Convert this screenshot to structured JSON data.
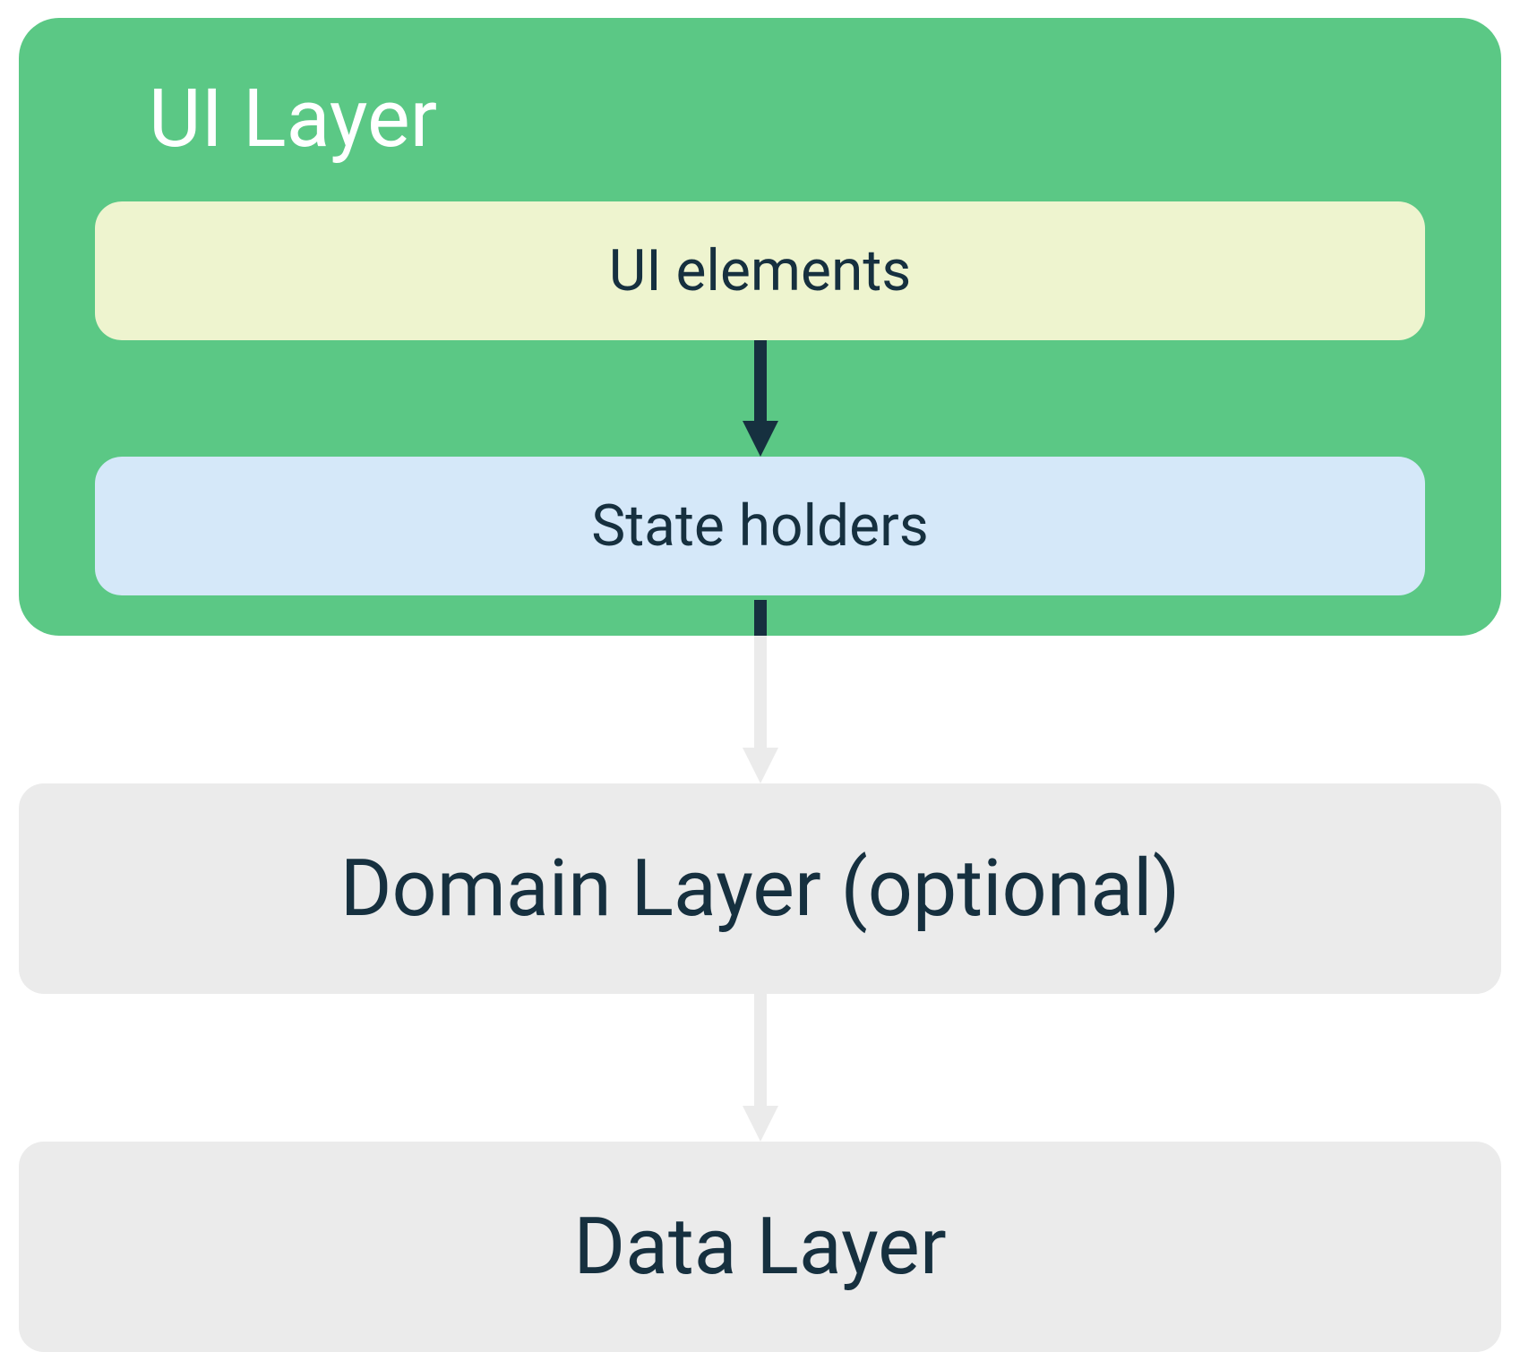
{
  "diagram": {
    "ui_layer": {
      "title": "UI Layer",
      "ui_elements_label": "UI elements",
      "state_holders_label": "State holders"
    },
    "domain_layer_label": "Domain Layer (optional)",
    "data_layer_label": "Data Layer",
    "colors": {
      "ui_layer_bg": "#5bc885",
      "ui_elements_bg": "#eef4cf",
      "state_holders_bg": "#d5e8f9",
      "outer_box_bg": "#ebebeb",
      "text_dark": "#16303f",
      "text_white": "#ffffff",
      "arrow_dark": "#16303f",
      "arrow_light": "#ebebeb"
    }
  }
}
